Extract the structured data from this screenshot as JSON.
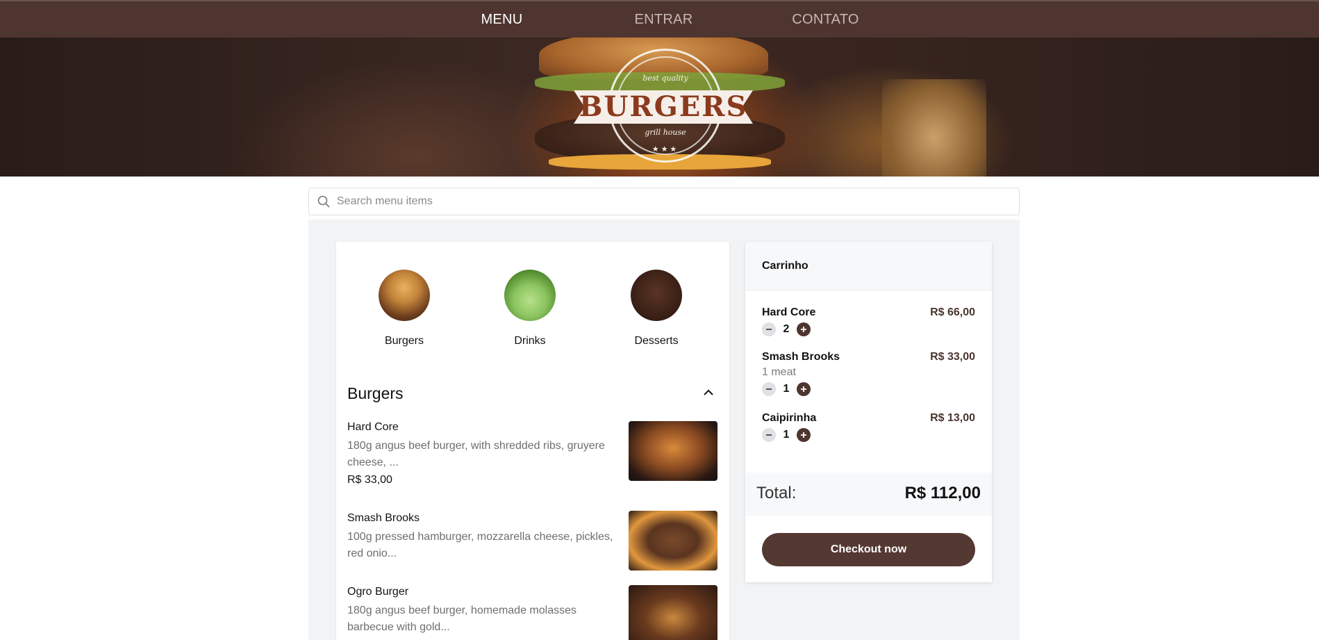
{
  "nav": {
    "tabs": [
      {
        "label": "MENU",
        "active": true
      },
      {
        "label": "ENTRAR",
        "active": false
      },
      {
        "label": "CONTATO",
        "active": false
      }
    ]
  },
  "hero": {
    "logo_text": "BURGERS",
    "logo_arc_top": "best quality",
    "logo_arc_bottom": "grill house",
    "logo_stars": "★★★"
  },
  "search": {
    "placeholder": "Search menu items",
    "value": ""
  },
  "categories": [
    {
      "label": "Burgers",
      "icon": "burger-thumbnail"
    },
    {
      "label": "Drinks",
      "icon": "drink-thumbnail"
    },
    {
      "label": "Desserts",
      "icon": "dessert-thumbnail"
    }
  ],
  "section": {
    "title": "Burgers",
    "items": [
      {
        "name": "Hard Core",
        "description": "180g angus beef burger, with shredded ribs, gruyere cheese, ...",
        "price": "R$ 33,00"
      },
      {
        "name": "Smash Brooks",
        "description": "100g pressed hamburger, mozzarella cheese, pickles, red onio...",
        "price": ""
      },
      {
        "name": "Ogro Burger",
        "description": "180g angus beef burger, homemade molasses barbecue with gold...",
        "price": ""
      }
    ]
  },
  "cart": {
    "title": "Carrinho",
    "items": [
      {
        "name": "Hard Core",
        "price": "R$ 66,00",
        "option": "",
        "qty": "2"
      },
      {
        "name": "Smash Brooks",
        "price": "R$ 33,00",
        "option": "1 meat",
        "qty": "1"
      },
      {
        "name": "Caipirinha",
        "price": "R$ 13,00",
        "option": "",
        "qty": "1"
      }
    ],
    "total_label": "Total:",
    "total_value": "R$ 112,00",
    "checkout_label": "Checkout now"
  },
  "colors": {
    "brand": "#4e3530",
    "button": "#543832",
    "background": "#f2f3f5"
  }
}
